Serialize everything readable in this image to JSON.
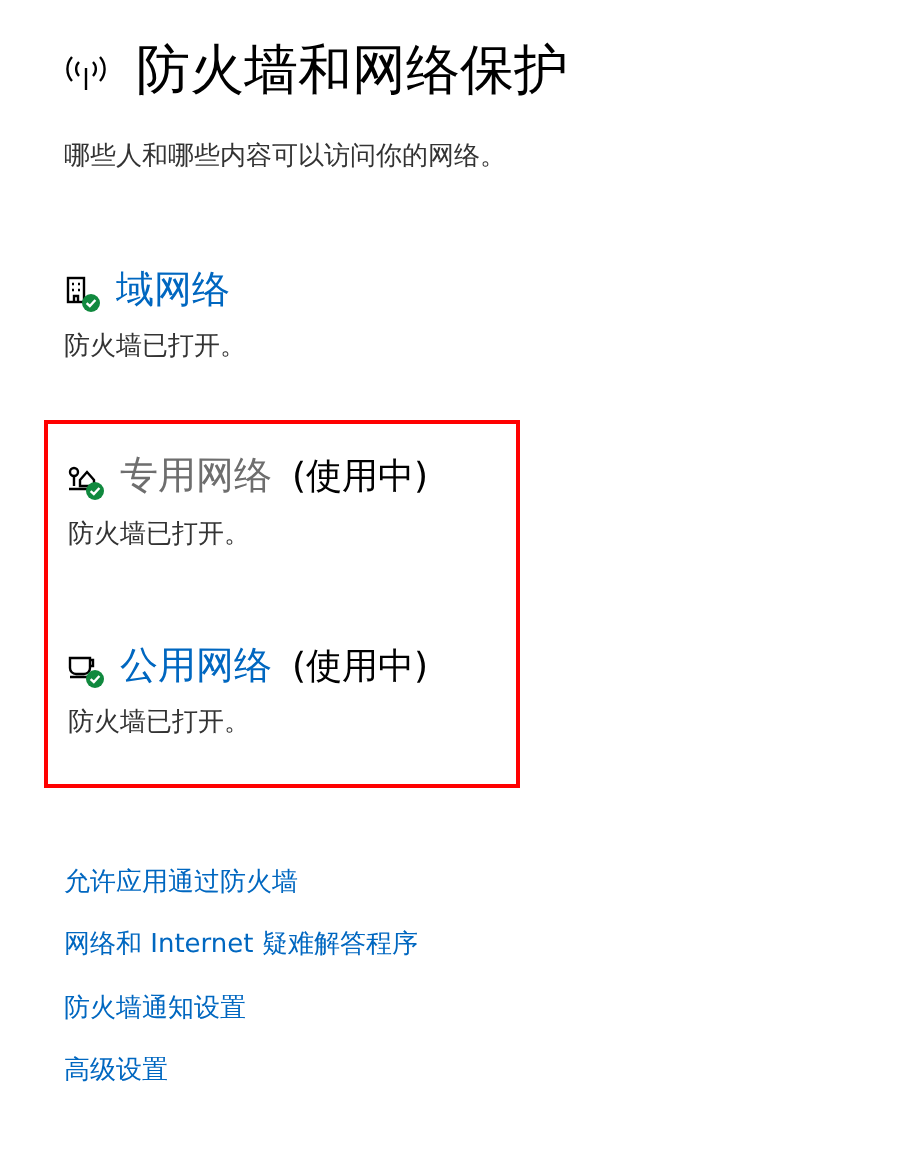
{
  "header": {
    "title": "防火墙和网络保护",
    "subtitle": "哪些人和哪些内容可以访问你的网络。"
  },
  "networks": [
    {
      "kind": "domain",
      "name": "域网络",
      "dimmed": false,
      "status": "防火墙已打开。",
      "highlighted": false
    },
    {
      "kind": "private",
      "name": "专用网络",
      "dimmed": true,
      "in_use": "(使用中)",
      "status": "防火墙已打开。",
      "highlighted": true
    },
    {
      "kind": "public",
      "name": "公用网络",
      "dimmed": false,
      "in_use": "(使用中)",
      "status": "防火墙已打开。",
      "highlighted": true
    }
  ],
  "links": [
    "允许应用通过防火墙",
    "网络和 Internet 疑难解答程序",
    "防火墙通知设置",
    "高级设置"
  ]
}
